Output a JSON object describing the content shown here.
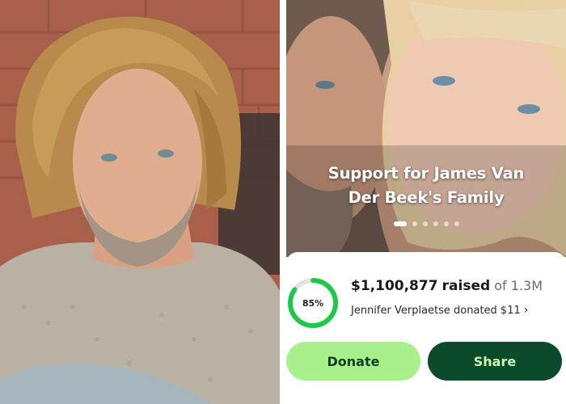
{
  "campaign": {
    "title_line1": "Support for James Van",
    "title_line2": "Der Beek's Family",
    "carousel": {
      "total_slides": 6,
      "active_slide": 1
    }
  },
  "progress": {
    "percent_label": "85%",
    "fraction": 0.85,
    "raised_amount": "$1,100,877",
    "raised_word": "raised",
    "goal_text": "of 1.3M",
    "recent_donation": "Jennifer Verplaetse donated $11",
    "chevron": "›"
  },
  "actions": {
    "donate_label": "Donate",
    "share_label": "Share"
  },
  "colors": {
    "progress_green": "#1fc84a",
    "progress_track": "#e3e3e3",
    "donate_bg": "#a8f08b",
    "share_bg": "#0b4a2b"
  }
}
